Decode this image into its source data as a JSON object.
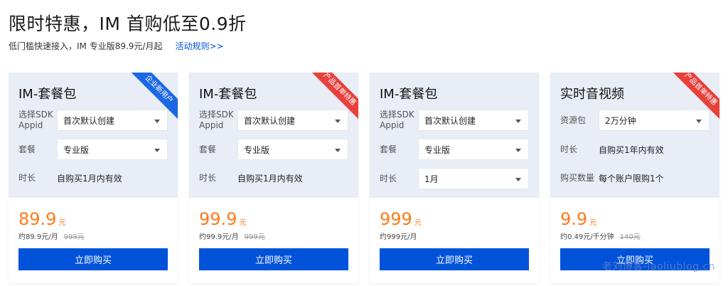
{
  "header": {
    "title": "限时特惠，IM 首购低至0.9折",
    "subtitle": "低门槛快速接入，IM 专业版89.9元/月起",
    "rules_link": "活动规则>>"
  },
  "cards": [
    {
      "title": "IM-套餐包",
      "ribbon": "企业新用户",
      "ribbon_color": "#1c67e3",
      "rows": [
        {
          "label": "选择SDK Appid",
          "type": "select",
          "value": "首次默认创建"
        },
        {
          "label": "套餐",
          "type": "select",
          "value": "专业版"
        },
        {
          "label": "时长",
          "type": "text",
          "value": "自购买1月内有效"
        }
      ],
      "price": "89.9",
      "price_unit": "元",
      "price_note": "约89.9元/月",
      "original_price": "999元",
      "buy_label": "立即购买"
    },
    {
      "title": "IM-套餐包",
      "ribbon": "产品首单特惠",
      "ribbon_color": "#e8403b",
      "rows": [
        {
          "label": "选择SDK Appid",
          "type": "select",
          "value": "首次默认创建"
        },
        {
          "label": "套餐",
          "type": "select",
          "value": "专业版"
        },
        {
          "label": "时长",
          "type": "text",
          "value": "自购买1月内有效"
        }
      ],
      "price": "99.9",
      "price_unit": "元",
      "price_note": "约99.9元/月",
      "original_price": "999元",
      "buy_label": "立即购买"
    },
    {
      "title": "IM-套餐包",
      "ribbon": "",
      "ribbon_color": "",
      "rows": [
        {
          "label": "选择SDK Appid",
          "type": "select",
          "value": "首次默认创建"
        },
        {
          "label": "套餐",
          "type": "select",
          "value": "专业版"
        },
        {
          "label": "时长",
          "type": "select",
          "value": "1月"
        }
      ],
      "price": "999",
      "price_unit": "元",
      "price_note": "约999元/月",
      "original_price": "",
      "buy_label": "立即购买"
    },
    {
      "title": "实时音视频",
      "ribbon": "产品首单特惠",
      "ribbon_color": "#e8403b",
      "rows": [
        {
          "label": "资源包",
          "type": "select",
          "value": "2万分钟"
        },
        {
          "label": "时长",
          "type": "text",
          "value": "自购买1年内有效"
        },
        {
          "label": "购买数量",
          "type": "text",
          "value": "每个账户限购1个"
        }
      ],
      "price": "9.9",
      "price_unit": "元",
      "price_note": "约0.49元/千分钟",
      "original_price": "140元",
      "buy_label": "立即购买"
    }
  ],
  "watermark": "老刘博客-laoliublog.cn"
}
